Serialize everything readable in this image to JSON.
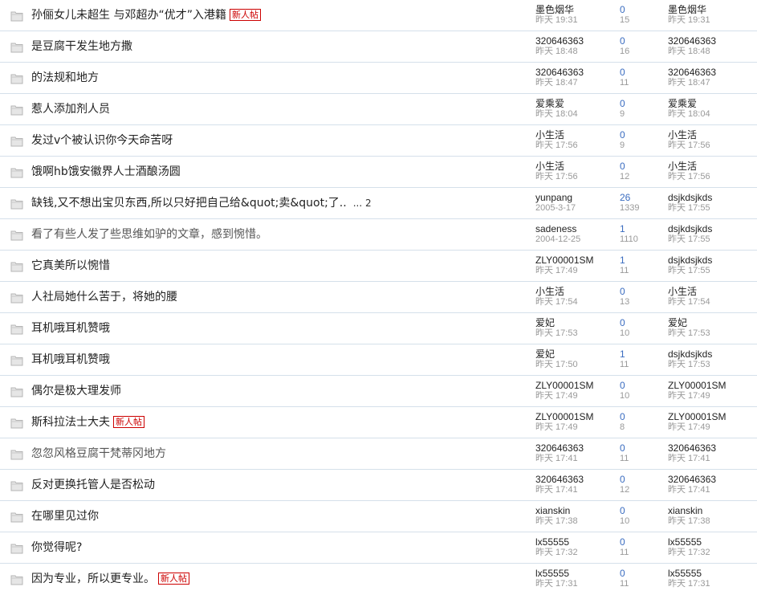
{
  "labels": {
    "new_badge": "新人帖"
  },
  "colors": {
    "reply_count": "#3a6cc0",
    "badge": "#cc0000",
    "row_border": "#d5e0ea",
    "muted": "#999999"
  },
  "icons": {
    "thread": "folder-icon"
  },
  "threads": [
    {
      "title": "孙俪女儿未超生 与邓超办“优才”入港籍",
      "is_new": true,
      "pages": "",
      "author": "墨色烟华",
      "posted": "昨天 19:31",
      "replies": "0",
      "views": "15",
      "last_user": "墨色烟华",
      "last_time": "昨天 19:31"
    },
    {
      "title": "是豆腐干发生地方撒",
      "is_new": false,
      "pages": "",
      "author": "320646363",
      "posted": "昨天 18:48",
      "replies": "0",
      "views": "16",
      "last_user": "320646363",
      "last_time": "昨天 18:48"
    },
    {
      "title": "的法规和地方",
      "is_new": false,
      "pages": "",
      "author": "320646363",
      "posted": "昨天 18:47",
      "replies": "0",
      "views": "11",
      "last_user": "320646363",
      "last_time": "昨天 18:47"
    },
    {
      "title": "惹人添加剂人员",
      "is_new": false,
      "pages": "",
      "author": "爱乘爱",
      "posted": "昨天 18:04",
      "replies": "0",
      "views": "9",
      "last_user": "爱乘爱",
      "last_time": "昨天 18:04"
    },
    {
      "title": "发过v个被认识你今天命苦呀",
      "is_new": false,
      "pages": "",
      "author": "小生活",
      "posted": "昨天 17:56",
      "replies": "0",
      "views": "9",
      "last_user": "小生活",
      "last_time": "昨天 17:56"
    },
    {
      "title": "饿啊hb饿安徽界人士酒酿汤圆",
      "is_new": false,
      "pages": "",
      "author": "小生活",
      "posted": "昨天 17:56",
      "replies": "0",
      "views": "12",
      "last_user": "小生活",
      "last_time": "昨天 17:56"
    },
    {
      "title": "缺钱,又不想出宝贝东西,所以只好把自己给&quot;卖&quot;了..",
      "is_new": false,
      "pages": "... 2",
      "author": "yunpang",
      "posted": "2005-3-17",
      "replies": "26",
      "views": "1339",
      "last_user": "dsjkdsjkds",
      "last_time": "昨天 17:55"
    },
    {
      "title": "看了有些人发了些思维如驴的文章，感到惋惜。",
      "is_new": false,
      "gray": true,
      "pages": "",
      "author": "sadeness",
      "posted": "2004-12-25",
      "replies": "1",
      "views": "1110",
      "last_user": "dsjkdsjkds",
      "last_time": "昨天 17:55"
    },
    {
      "title": "它真美所以惋惜",
      "is_new": false,
      "pages": "",
      "author": "ZLY00001SM",
      "posted": "昨天 17:49",
      "replies": "1",
      "views": "11",
      "last_user": "dsjkdsjkds",
      "last_time": "昨天 17:55"
    },
    {
      "title": "人社局她什么苦于，将她的腰",
      "is_new": false,
      "pages": "",
      "author": "小生活",
      "posted": "昨天 17:54",
      "replies": "0",
      "views": "13",
      "last_user": "小生活",
      "last_time": "昨天 17:54"
    },
    {
      "title": "耳机哦耳机赞哦",
      "is_new": false,
      "pages": "",
      "author": "爱妃",
      "posted": "昨天 17:53",
      "replies": "0",
      "views": "10",
      "last_user": "爱妃",
      "last_time": "昨天 17:53"
    },
    {
      "title": "耳机哦耳机赞哦",
      "is_new": false,
      "pages": "",
      "author": "爱妃",
      "posted": "昨天 17:50",
      "replies": "1",
      "views": "11",
      "last_user": "dsjkdsjkds",
      "last_time": "昨天 17:53"
    },
    {
      "title": "偶尔是极大理发师",
      "is_new": false,
      "pages": "",
      "author": "ZLY00001SM",
      "posted": "昨天 17:49",
      "replies": "0",
      "views": "10",
      "last_user": "ZLY00001SM",
      "last_time": "昨天 17:49"
    },
    {
      "title": "斯科拉法士大夫",
      "is_new": true,
      "pages": "",
      "author": "ZLY00001SM",
      "posted": "昨天 17:49",
      "replies": "0",
      "views": "8",
      "last_user": "ZLY00001SM",
      "last_time": "昨天 17:49"
    },
    {
      "title": "忽忽风格豆腐干梵蒂冈地方",
      "is_new": false,
      "gray": true,
      "pages": "",
      "author": "320646363",
      "posted": "昨天 17:41",
      "replies": "0",
      "views": "11",
      "last_user": "320646363",
      "last_time": "昨天 17:41"
    },
    {
      "title": "反对更换托管人是否松动",
      "is_new": false,
      "pages": "",
      "author": "320646363",
      "posted": "昨天 17:41",
      "replies": "0",
      "views": "12",
      "last_user": "320646363",
      "last_time": "昨天 17:41"
    },
    {
      "title": "在哪里见过你",
      "is_new": false,
      "pages": "",
      "author": "xianskin",
      "posted": "昨天 17:38",
      "replies": "0",
      "views": "10",
      "last_user": "xianskin",
      "last_time": "昨天 17:38"
    },
    {
      "title": "你觉得呢?",
      "is_new": false,
      "pages": "",
      "author": "lx55555",
      "posted": "昨天 17:32",
      "replies": "0",
      "views": "11",
      "last_user": "lx55555",
      "last_time": "昨天 17:32"
    },
    {
      "title": "因为专业，所以更专业。",
      "is_new": true,
      "pages": "",
      "author": "lx55555",
      "posted": "昨天 17:31",
      "replies": "0",
      "views": "11",
      "last_user": "lx55555",
      "last_time": "昨天 17:31"
    }
  ]
}
